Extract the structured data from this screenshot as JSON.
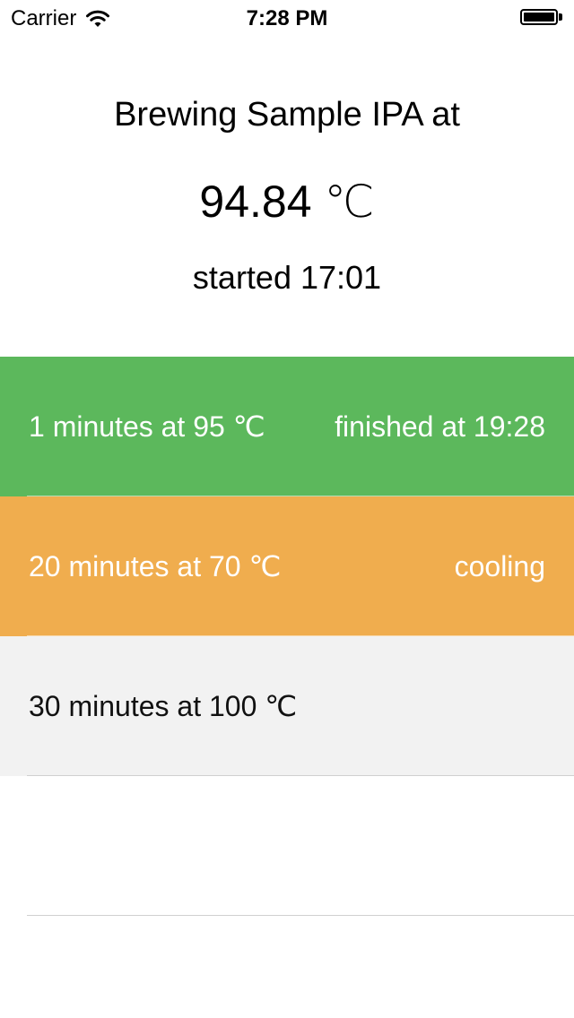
{
  "status_bar": {
    "carrier": "Carrier",
    "time": "7:28 PM",
    "wifi_icon": "wifi-icon",
    "battery_icon": "battery-icon",
    "battery_level": 1.0
  },
  "brew": {
    "title": "Brewing Sample IPA at",
    "current_temp": "94.84 ℃",
    "started": "started 17:01"
  },
  "steps": [
    {
      "description": "1 minutes at  95 ℃",
      "status": "finished at 19:28",
      "state_color": "#5cb85c"
    },
    {
      "description": "20 minutes at  70 ℃",
      "status": "cooling",
      "state_color": "#f0ad4e"
    },
    {
      "description": "30 minutes at  100 ℃",
      "status": "",
      "state_color": "#f2f2f2"
    }
  ]
}
